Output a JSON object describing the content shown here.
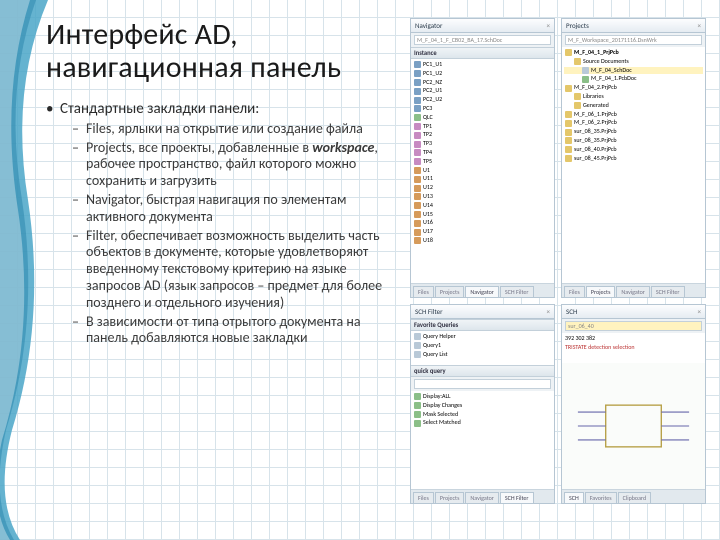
{
  "title": "Интерфейс AD, навигационная панель",
  "bullets": {
    "main": "Стандартные закладки панели:",
    "items": [
      "Files, ярлыки на открытие или создание файла",
      "Projects, все проекты, добавленные в workspace, рабочее пространство, файл которого можно сохранить и загрузить",
      "Navigator, быстрая навигация по элементам активного документа",
      "Filter, обеспечивает возможность выделить часть объектов в документе, которые удовлетворяют введенному текстовому критерию на языке запросов AD (язык запросов – предмет для более позднего и отдельного изучения)",
      "В зависимости от типа отрытого документа на панель добавляются новые закладки"
    ]
  },
  "panels": {
    "nav1": {
      "title": "Navigator",
      "group": "M_F_04_1_F_CB02_BA_17.SchDoc",
      "items": [
        "PC1_U1",
        "PC1_U2",
        "PC2_NZ",
        "PC2_U1",
        "PC2_U2",
        "PC3",
        "QLC",
        "TP1",
        "TP2",
        "TP3",
        "TP4",
        "TP5",
        "U1",
        "U11",
        "U12",
        "U13",
        "U14",
        "U15",
        "U16",
        "U17",
        "U18"
      ],
      "tabs": [
        "Files",
        "Projects",
        "Navigator",
        "SCH Filter"
      ]
    },
    "nav2": {
      "title": "Projects",
      "workspace": "M_F_Workspace_20171116.DsnWrk",
      "items": [
        "M_F_04_1_PrjPcb",
        "Source Documents",
        "M_F_04_SchDoc",
        "M_F_04_1.PcbDoc",
        "M_F_04_2.PrjPcb",
        "Libraries",
        "Generated",
        "M_F_06_1.PrjPcb",
        "M_F_06_2.PrjPcb",
        "sur_08_35.PrjPcb",
        "sur_08_35.PrjPcb",
        "sur_08_40.PrjPcb",
        "sur_08_45.PrjPcb"
      ],
      "tabs": [
        "Files",
        "Projects",
        "Navigator",
        "SCH Filter"
      ]
    },
    "filter": {
      "title": "SCH Filter",
      "groups": [
        "Favorite Queries",
        "Query Helper",
        "Query1",
        "Query List",
        "quick query",
        "Display:ALL",
        "Display Changes",
        "Mask Selected",
        "Select Matched"
      ],
      "tabs": [
        "Files",
        "Projects",
        "Navigator",
        "SCH Filter"
      ]
    },
    "files": {
      "title": "SCH",
      "item_selected": "sur_06_40",
      "hex_a": "392  302  382",
      "hex_b": "TRISTATE detection selection",
      "tabs": [
        "SCH",
        "Favorites",
        "Clipboard"
      ]
    }
  }
}
